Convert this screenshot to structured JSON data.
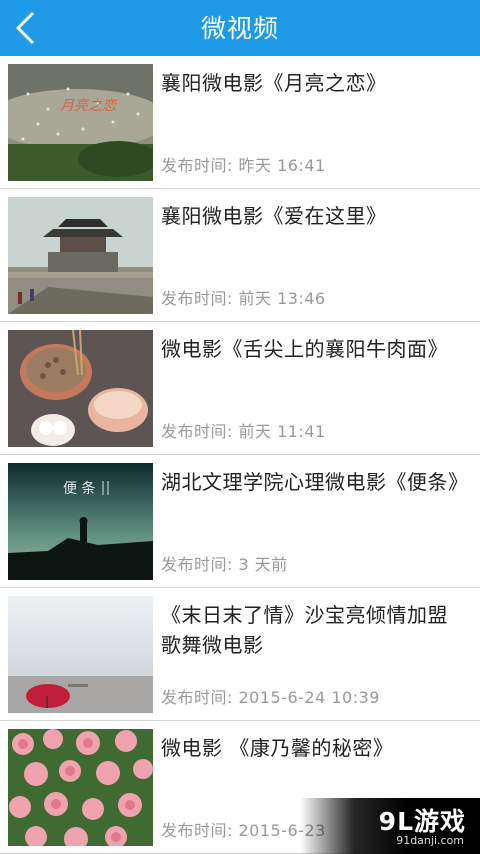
{
  "header": {
    "title": "微视频",
    "back_icon": "chevron-left-icon"
  },
  "colors": {
    "header_bg": "#1e9ae6",
    "time_text": "#9a9a9a"
  },
  "videos": [
    {
      "title": "襄阳微电影《月亮之恋》",
      "time": "发布时间: 昨天 16:41"
    },
    {
      "title": "襄阳微电影《爱在这里》",
      "time": "发布时间: 前天 13:46"
    },
    {
      "title": "微电影《舌尖上的襄阳牛肉面》",
      "time": "发布时间: 前天 11:41"
    },
    {
      "title": "湖北文理学院心理微电影《便条》",
      "time": "发布时间: 3 天前"
    },
    {
      "title": "《末日末了情》沙宝亮倾情加盟歌舞微电影",
      "time": "发布时间: 2015-6-24 10:39"
    },
    {
      "title": "微电影 《康乃馨的秘密》",
      "time": "发布时间: 2015-6-23"
    }
  ],
  "watermark": {
    "logo": "9L游戏",
    "site": "91danji.com"
  }
}
